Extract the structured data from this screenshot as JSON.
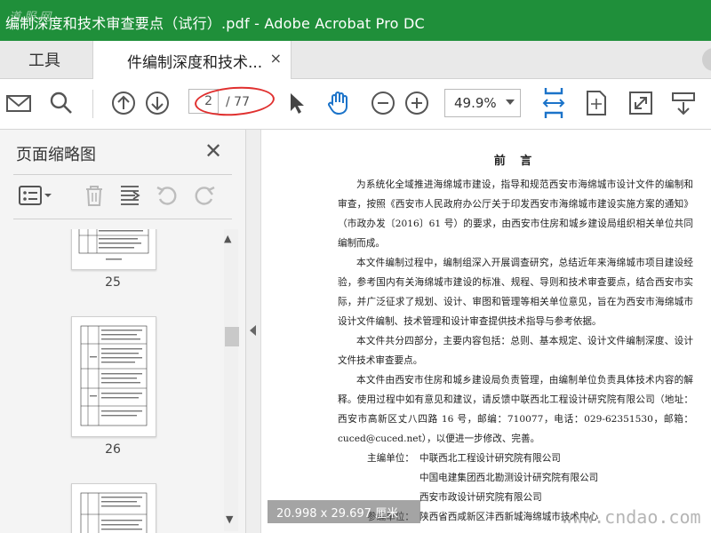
{
  "window": {
    "title": "编制深度和技术审查要点（试行）.pdf - Adobe Acrobat Pro DC"
  },
  "tabs": {
    "tools_label": "工具",
    "doc_label": "件编制深度和技术...",
    "close_glyph": "×"
  },
  "toolbar": {
    "page_current": "2",
    "page_total": "/ 77",
    "zoom": "49.9%"
  },
  "panel": {
    "title": "页面缩略图",
    "close_glyph": "✕",
    "thumbnails": [
      {
        "number": "25"
      },
      {
        "number": "26"
      }
    ]
  },
  "document": {
    "heading": "前 言",
    "paragraphs": [
      "为系统化全域推进海绵城市建设，指导和规范西安市海绵城市设计文件的编制和审查，按照《西安市人民政府办公厅关于印发西安市海绵城市建设实施方案的通知》（市政办发〔2016〕61 号）的要求，由西安市住房和城乡建设局组织相关单位共同编制而成。",
      "本文件编制过程中，编制组深入开展调查研究，总结近年来海绵城市项目建设经验，参考国内有关海绵城市建设的标准、规程、导则和技术审查要点，结合西安市实际，并广泛征求了规划、设计、审图和管理等相关单位意见，旨在为西安市海绵城市设计文件编制、技术管理和设计审查提供技术指导与参考依据。",
      "本文件共分四部分，主要内容包括：总则、基本规定、设计文件编制深度、设计文件技术审查要点。",
      "本文件由西安市住房和城乡建设局负责管理，由编制单位负责具体技术内容的解释。使用过程中如有意见和建议，请反馈中联西北工程设计研究院有限公司（地址：西安市高新区丈八四路 16 号，邮编：710077，电话：029-62351530，邮箱：cuced@cuced.net），以便进一步修改、完善。"
    ],
    "org_rows": [
      {
        "label": "主编单位：",
        "value": "中联西北工程设计研究院有限公司"
      },
      {
        "label": "",
        "value": "中国电建集团西北勘测设计研究院有限公司"
      },
      {
        "label": "",
        "value": "西安市政设计研究院有限公司"
      },
      {
        "label": "参编单位：",
        "value": "陕西省西咸新区沣西新城海绵城市技术中心"
      }
    ]
  },
  "status": {
    "page_size": "20.998 x 29.697 厘米"
  },
  "watermarks": {
    "site": "www.cndao.com",
    "logo": "道 服 网"
  },
  "colors": {
    "titlebar": "#1f8f3a",
    "accent_blue": "#1b73c9",
    "annotation_red": "#e0302f"
  }
}
